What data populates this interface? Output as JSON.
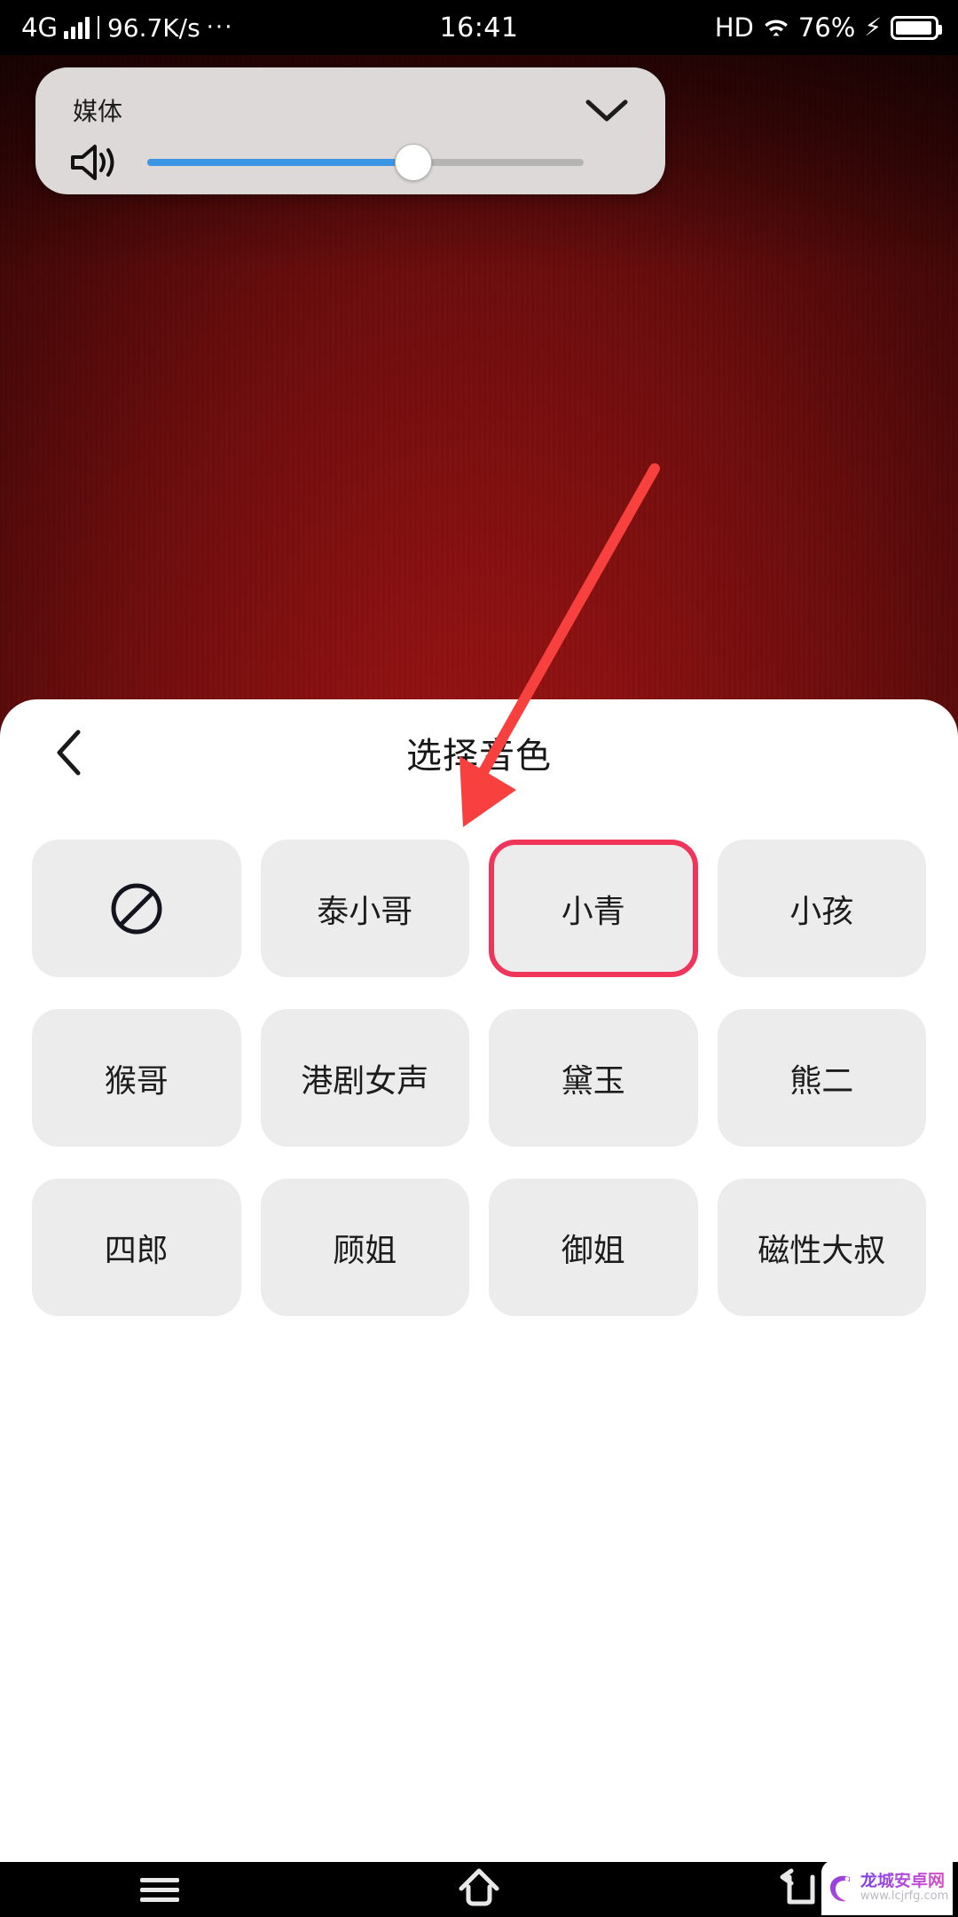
{
  "status_bar": {
    "network_type": "4G",
    "net_speed": "96.7K/s",
    "overflow_dots": "···",
    "time": "16:41",
    "hd_label": "HD",
    "battery_percent": "76%",
    "signal_icon": "signal-bars-icon",
    "wifi_icon": "wifi-icon",
    "battery_icon": "battery-icon",
    "charging_icon": "charging-bolt-icon"
  },
  "volume_panel": {
    "label": "媒体",
    "collapse_icon": "chevron-down-icon",
    "speaker_icon": "speaker-wave-icon",
    "slider_value": 61,
    "fill_color": "#3b95e3",
    "track_color": "#b6b4b3",
    "panel_color": "#dcd9d8"
  },
  "annotation": {
    "arrow_icon": "red-arrow-icon",
    "color": "#f8413f"
  },
  "sheet": {
    "back_icon": "chevron-left-icon",
    "title": "选择音色",
    "selected_border_color": "#f0345a",
    "tile_color": "#ececed",
    "voices": [
      {
        "label": "",
        "icon": "no-entry-icon",
        "selected": false
      },
      {
        "label": "泰小哥",
        "icon": "",
        "selected": false
      },
      {
        "label": "小青",
        "icon": "",
        "selected": true
      },
      {
        "label": "小孩",
        "icon": "",
        "selected": false
      },
      {
        "label": "猴哥",
        "icon": "",
        "selected": false
      },
      {
        "label": "港剧女声",
        "icon": "",
        "selected": false
      },
      {
        "label": "黛玉",
        "icon": "",
        "selected": false
      },
      {
        "label": "熊二",
        "icon": "",
        "selected": false
      },
      {
        "label": "四郎",
        "icon": "",
        "selected": false
      },
      {
        "label": "顾姐",
        "icon": "",
        "selected": false
      },
      {
        "label": "御姐",
        "icon": "",
        "selected": false
      },
      {
        "label": "磁性大叔",
        "icon": "",
        "selected": false
      }
    ]
  },
  "navbar": {
    "menu_icon": "menu-recents-icon",
    "home_icon": "home-icon",
    "back_icon": "back-arrow-icon"
  },
  "watermark": {
    "title": "龙城安卓网",
    "url": "www.lcjrfg.com",
    "logo_icon": "dragon-logo-icon"
  }
}
